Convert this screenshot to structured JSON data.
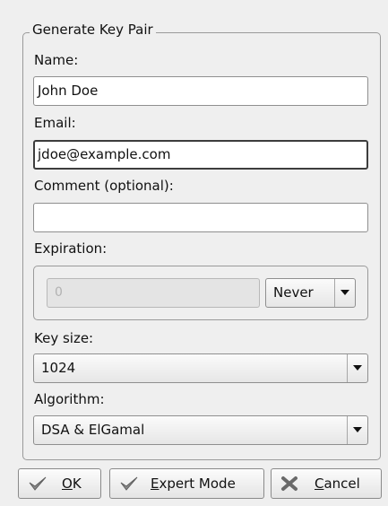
{
  "dialog": {
    "group_title": "Generate Key Pair",
    "name": {
      "label": "Name:",
      "value": "John Doe"
    },
    "email": {
      "label": "Email:",
      "value": "jdoe@example.com"
    },
    "comment": {
      "label": "Comment (optional):",
      "value": ""
    },
    "expiration": {
      "label": "Expiration:",
      "days_value": "0",
      "unit": "Never"
    },
    "key_size": {
      "label": "Key size:",
      "value": "1024"
    },
    "algorithm": {
      "label": "Algorithm:",
      "value": "DSA & ElGamal"
    }
  },
  "buttons": {
    "ok": {
      "mnemonic": "O",
      "rest": "K"
    },
    "expert": {
      "mnemonic": "E",
      "rest": "xpert Mode"
    },
    "cancel": {
      "mnemonic": "C",
      "rest": "ancel"
    }
  },
  "icons": {
    "ok": "checkmark-icon",
    "expert": "checkmark-icon",
    "cancel": "x-icon",
    "dropdown": "arrow-down-icon"
  }
}
